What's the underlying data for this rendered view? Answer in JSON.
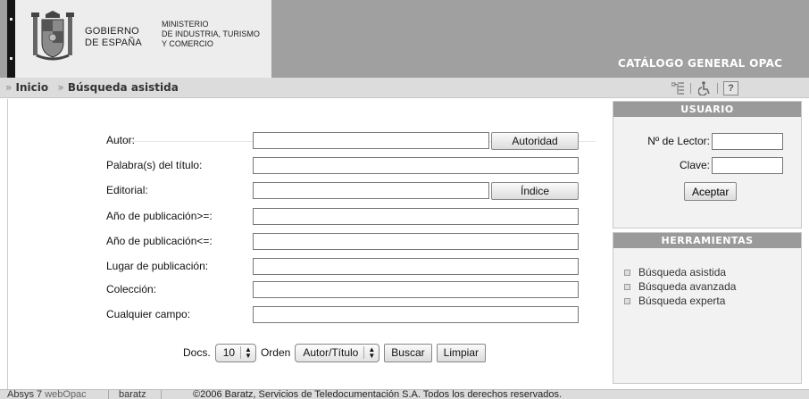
{
  "header": {
    "gobierno_line1": "GOBIERNO",
    "gobierno_line2": "DE ESPAÑA",
    "ministerio_line1": "MINISTERIO",
    "ministerio_line2": "DE INDUSTRIA, TURISMO",
    "ministerio_line3": "Y COMERCIO",
    "catalog_title": "CATÁLOGO GENERAL OPAC",
    "icons": [
      "sitemap-icon",
      "accessibility-icon",
      "help-icon"
    ],
    "help_label": "?"
  },
  "breadcrumb": {
    "sep": "»",
    "home": "Inicio",
    "current": "Búsqueda asistida"
  },
  "form": {
    "fields": [
      {
        "label": "Autor:",
        "value": "",
        "button": "Autoridad"
      },
      {
        "label": "Palabra(s) del título:",
        "value": ""
      },
      {
        "label": "Editorial:",
        "value": "",
        "button": "Índice"
      },
      {
        "label": "Año de publicación>=:",
        "value": ""
      },
      {
        "label": "Año de publicación<=:",
        "value": ""
      },
      {
        "label": "Lugar de publicación:",
        "value": ""
      },
      {
        "label": "Colección:",
        "value": ""
      },
      {
        "label": "Cualquier campo:",
        "value": ""
      }
    ],
    "docs_label": "Docs.",
    "docs_value": "10",
    "orden_label": "Orden",
    "orden_value": "Autor/Título",
    "buscar": "Buscar",
    "limpiar": "Limpiar"
  },
  "usuario": {
    "title": "USUARIO",
    "lector_label": "Nº de Lector:",
    "clave_label": "Clave:",
    "aceptar": "Aceptar"
  },
  "herramientas": {
    "title": "HERRAMIENTAS",
    "items": [
      "Búsqueda asistida",
      "Búsqueda avanzada",
      "Búsqueda experta"
    ]
  },
  "footer": {
    "absys_1": "Absys 7",
    "absys_2": "webOpac",
    "baratz": "baratz",
    "copyright": "©2006 Baratz, Servicios de Teledocumentación S.A. Todos los derechos reservados."
  }
}
